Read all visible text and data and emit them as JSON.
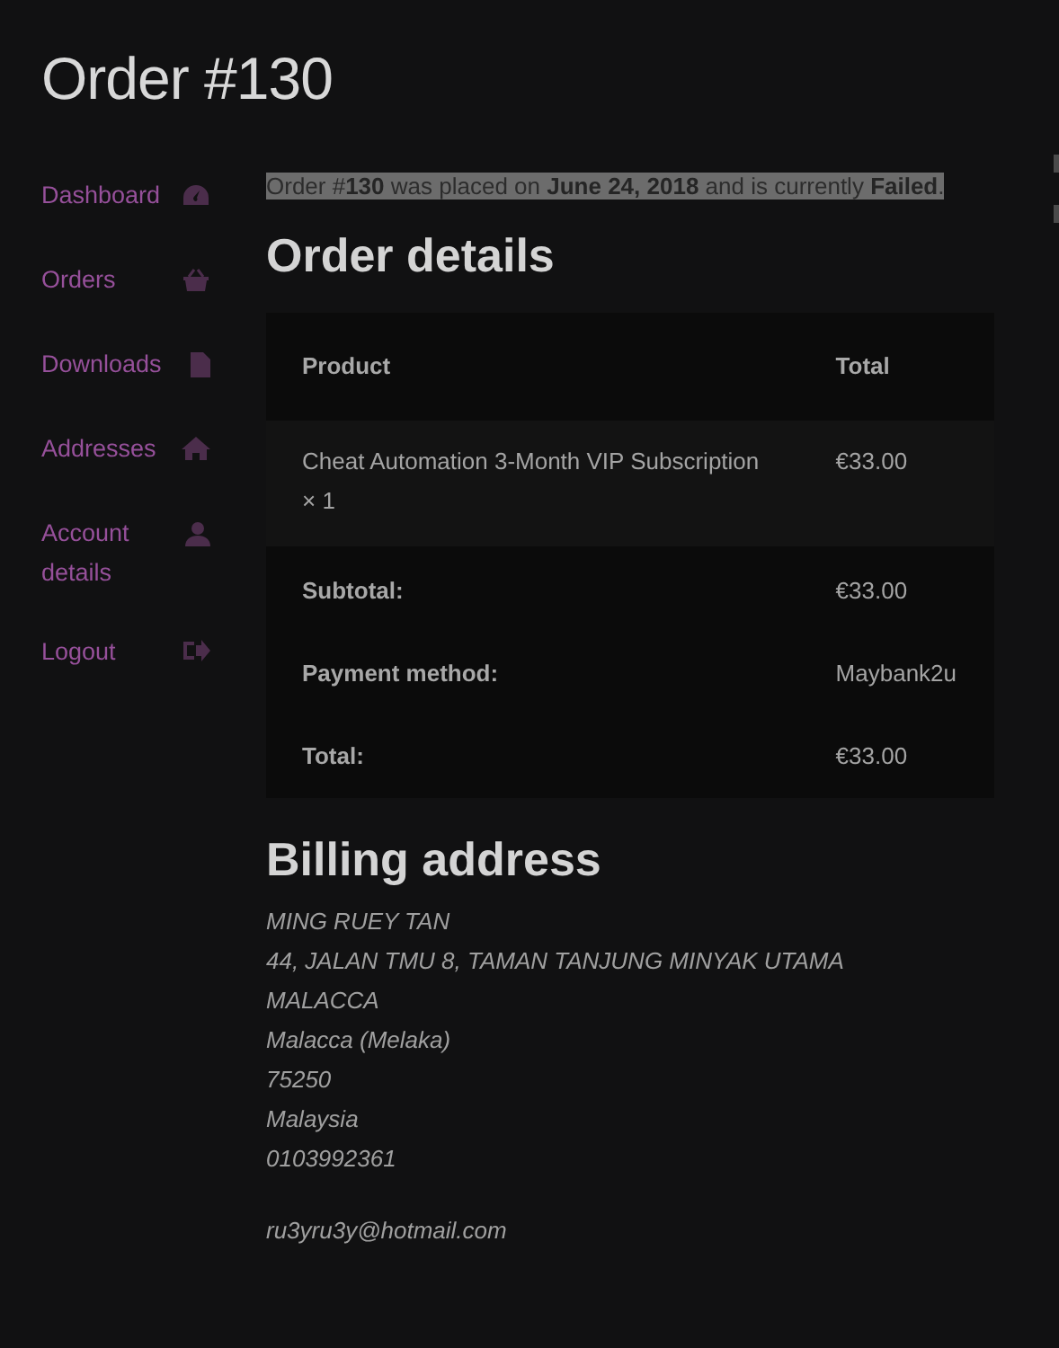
{
  "page_title": "Order #130",
  "sidebar": {
    "items": [
      {
        "label": "Dashboard",
        "selected": false
      },
      {
        "label": "Orders",
        "selected": false
      },
      {
        "label": "Downloads",
        "selected": false
      },
      {
        "label": "Addresses",
        "selected": false
      },
      {
        "label": "Account details",
        "selected": false
      },
      {
        "label": "Logout",
        "selected": false
      }
    ]
  },
  "order_notice": "Order #**130** was placed on **June 24, 2018** and is currently **Failed**.",
  "order_details": {
    "heading": "Order details",
    "columns": [
      "Product",
      "Total"
    ],
    "items": [
      {
        "product": "Cheat Automation 3-Month VIP Subscription",
        "quantity": "× 1",
        "total": "€33.00"
      }
    ],
    "summary": [
      {
        "label": "Subtotal:",
        "value": "€33.00"
      },
      {
        "label": "Payment method:",
        "value": "Maybank2u"
      },
      {
        "label": "Total:",
        "value": "€33.00"
      }
    ]
  },
  "billing_address": {
    "heading": "Billing address",
    "lines": [
      "MING RUEY TAN",
      "44, JALAN TMU 8, TAMAN TANJUNG MINYAK UTAMA",
      "MALACCA",
      "Malacca (Melaka)",
      "75250",
      "Malaysia",
      "0103992361"
    ],
    "email": "ru3yru3y@hotmail.com"
  }
}
